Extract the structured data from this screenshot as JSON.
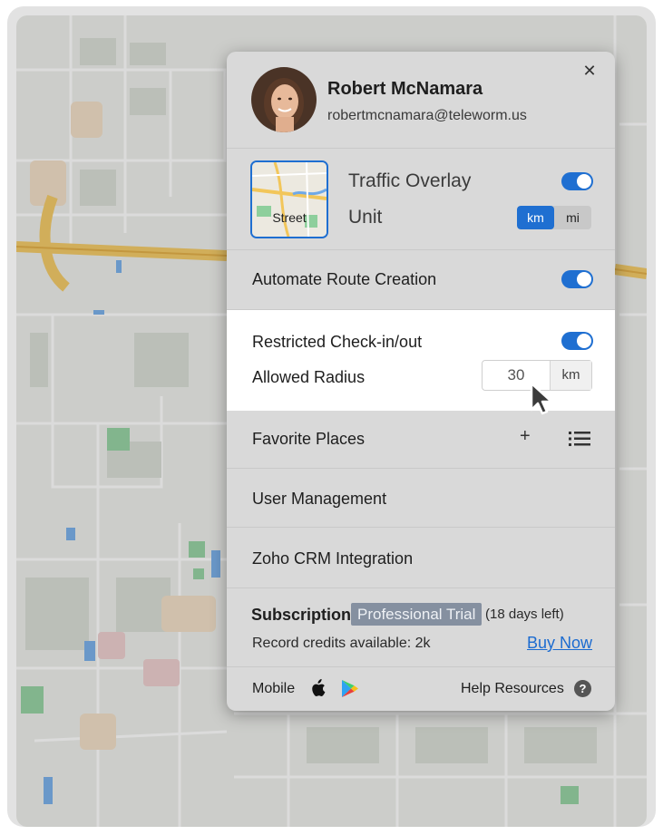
{
  "profile": {
    "name": "Robert McNamara",
    "email": "robertmcnamara@teleworm.us",
    "close_icon": "close-icon"
  },
  "map_view": {
    "thumbnail_label": "Street",
    "traffic_overlay_label": "Traffic Overlay",
    "traffic_overlay_on": true,
    "unit_label": "Unit",
    "unit_options": [
      "km",
      "mi"
    ],
    "unit_selected": "km"
  },
  "automate_route": {
    "label": "Automate Route Creation",
    "on": true
  },
  "checkin": {
    "label": "Restricted Check-in/out",
    "on": true,
    "radius_label": "Allowed Radius",
    "radius_value": "30",
    "radius_unit": "km"
  },
  "favorites": {
    "label": "Favorite Places",
    "add_icon": "plus-icon",
    "list_icon": "list-icon"
  },
  "menu": {
    "user_management": "User Management",
    "crm": "Zoho CRM Integration"
  },
  "subscription": {
    "label": "Subscription",
    "plan": "Professional Trial",
    "days_left": "(18 days left)",
    "credits": "Record credits available: 2k",
    "buy_now": "Buy Now"
  },
  "footer": {
    "mobile": "Mobile",
    "apple_icon": "apple-icon",
    "play_icon": "play-store-icon",
    "help": "Help Resources",
    "help_glyph": "?"
  },
  "colors": {
    "accent": "#1f6fd1",
    "panel_bg": "#d9d9d9",
    "badge_bg": "#8590a0",
    "link": "#1b6bd0"
  }
}
